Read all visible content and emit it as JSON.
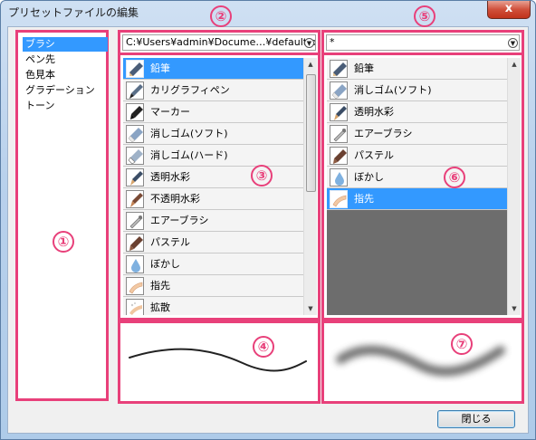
{
  "window": {
    "title": "プリセットファイルの編集",
    "close_glyph": "x"
  },
  "categories": [
    "ブラシ",
    "ペン先",
    "色見本",
    "グラデーション",
    "トーン"
  ],
  "selected_category": 0,
  "file_combo": {
    "value": "C:¥Users¥admin¥Docume…¥default.pmt"
  },
  "right_combo": {
    "value": "*"
  },
  "left_tools": [
    {
      "label": "鉛筆",
      "icon": "pencil-icon",
      "selected": true
    },
    {
      "label": "カリグラフィペン",
      "icon": "calligraphy-pen-icon"
    },
    {
      "label": "マーカー",
      "icon": "marker-icon"
    },
    {
      "label": "消しゴム(ソフト)",
      "icon": "eraser-soft-icon"
    },
    {
      "label": "消しゴム(ハード)",
      "icon": "eraser-hard-icon"
    },
    {
      "label": "透明水彩",
      "icon": "watercolor-icon"
    },
    {
      "label": "不透明水彩",
      "icon": "opaque-watercolor-icon"
    },
    {
      "label": "エアーブラシ",
      "icon": "airbrush-icon"
    },
    {
      "label": "パステル",
      "icon": "pastel-icon"
    },
    {
      "label": "ぼかし",
      "icon": "blur-icon"
    },
    {
      "label": "指先",
      "icon": "finger-icon"
    },
    {
      "label": "拡散",
      "icon": "diffuse-icon"
    }
  ],
  "right_tools": [
    {
      "label": "鉛筆",
      "icon": "pencil-icon"
    },
    {
      "label": "消しゴム(ソフト)",
      "icon": "eraser-soft-icon"
    },
    {
      "label": "透明水彩",
      "icon": "watercolor-icon"
    },
    {
      "label": "エアーブラシ",
      "icon": "airbrush-icon"
    },
    {
      "label": "パステル",
      "icon": "pastel-icon"
    },
    {
      "label": "ぼかし",
      "icon": "blur-icon"
    },
    {
      "label": "指先",
      "icon": "finger-icon",
      "selected": true
    }
  ],
  "callouts": [
    "①",
    "②",
    "③",
    "④",
    "⑤",
    "⑥",
    "⑦"
  ],
  "buttons": {
    "close_label": "閉じる"
  },
  "colors": {
    "annotation": "#e8407a",
    "selection": "#3399ff"
  }
}
